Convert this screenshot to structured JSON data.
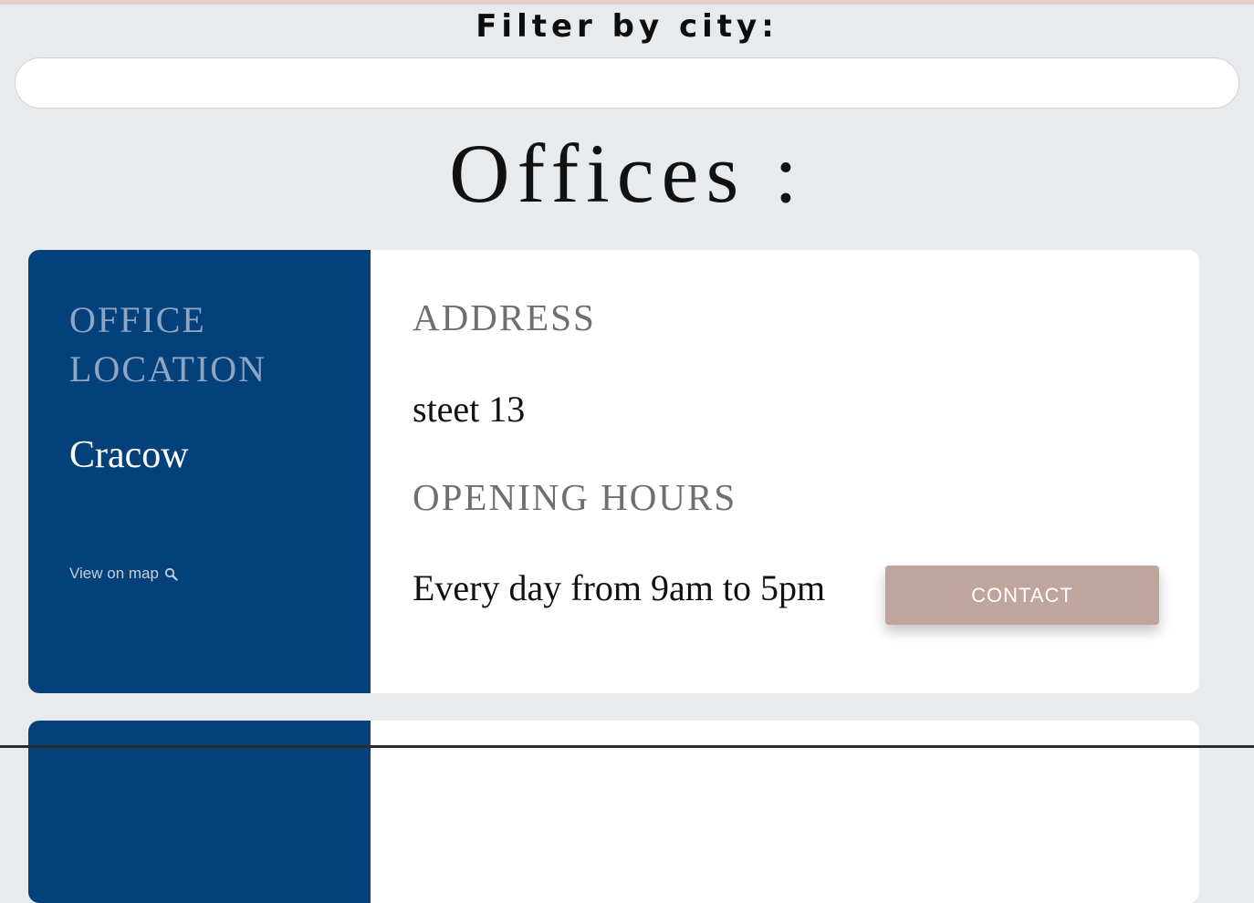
{
  "filter": {
    "label": "Filter by city:",
    "value": ""
  },
  "page": {
    "title": "Offices :"
  },
  "offices": [
    {
      "location_heading": "OFFICE LOCATION",
      "city": "Cracow",
      "map_link": "View on map",
      "address_heading": "ADDRESS",
      "address": "steet 13",
      "hours_heading": "OPENING HOURS",
      "hours": "Every day from 9am to 5pm",
      "contact_label": "CONTACT"
    }
  ],
  "colors": {
    "page_background": "#e8ebee",
    "card_left_panel": "#04417a",
    "contact_button": "#c0a59e",
    "top_bar": "#e6cfcb"
  },
  "icons": {
    "map_link_icon": "search-icon"
  }
}
